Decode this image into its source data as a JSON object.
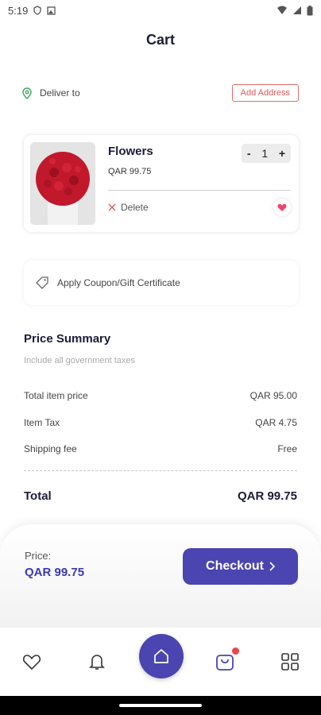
{
  "status_bar": {
    "time": "5:19"
  },
  "header": {
    "title": "Cart"
  },
  "delivery": {
    "label": "Deliver to",
    "add_address": "Add Address"
  },
  "cart_item": {
    "name": "Flowers",
    "price": "QAR 99.75",
    "quantity": "1",
    "decrement": "-",
    "increment": "+",
    "delete_label": "Delete"
  },
  "coupon": {
    "label": "Apply Coupon/Gift Certificate"
  },
  "price_summary": {
    "title": "Price Summary",
    "subtitle": "Include all government taxes",
    "rows": [
      {
        "label": "Total item price",
        "value": "QAR 95.00"
      },
      {
        "label": "Item Tax",
        "value": "QAR 4.75"
      },
      {
        "label": "Shipping fee",
        "value": "Free"
      }
    ],
    "total_label": "Total",
    "total_value": "QAR 99.75"
  },
  "checkout": {
    "price_label": "Price:",
    "price_value": "QAR 99.75",
    "button_label": "Checkout"
  },
  "colors": {
    "accent": "#4a45b0",
    "danger": "#e05a5a",
    "favorite": "#f0446a",
    "notification_dot": "#f04444"
  },
  "bottom_nav": {
    "items": [
      "heart-icon",
      "bell-icon",
      "home-icon",
      "bag-icon",
      "grid-icon"
    ],
    "active": "bag-icon"
  }
}
